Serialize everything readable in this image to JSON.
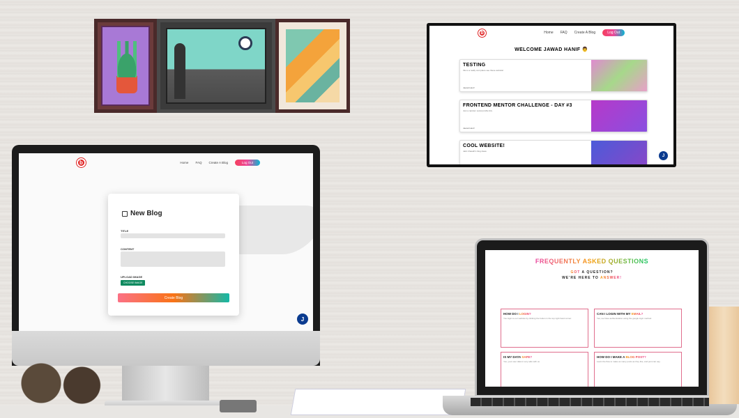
{
  "wall_art": [
    "succulent-painting",
    "starry-night-painting",
    "abstract-painting"
  ],
  "tv": {
    "logo": "b",
    "nav": [
      "Home",
      "FAQ",
      "Create A Blog"
    ],
    "logout": "Log Out",
    "welcome": "WELCOME JAWAD HANIF",
    "posts": [
      {
        "title": "TESTING",
        "excerpt": "this is a really cool place see these website!",
        "author": "Jawad Hanif"
      },
      {
        "title": "FRONTEND MENTOR CHALLENGE - DAY #3",
        "excerpt": "Just a random social profile link.",
        "author": "Jawad Hanif"
      },
      {
        "title": "COOL WEBSITE!",
        "excerpt": "Jatin bhaadri's blog ideas",
        "author": ""
      }
    ],
    "avatar": "J"
  },
  "imac": {
    "logo": "b",
    "nav": [
      "Home",
      "FAQ",
      "Create A Blog"
    ],
    "logout": "Log Out",
    "form_title": "New Blog",
    "title_label": "TITLE",
    "content_label": "CONTENT",
    "upload_label": "UPLOAD IMAGE",
    "choose_label": "CHOOSE IMAGE",
    "submit_label": "Create Blog",
    "avatar": "J"
  },
  "laptop": {
    "title": "FREQUENTLY ASKED QUESTIONS",
    "sub1_pre": "GOT",
    "sub1_post": "A QUESTION?",
    "sub2_pre": "WE'RE HERE TO",
    "sub2_post": "ANSWER!",
    "faqs": [
      {
        "q_pre": "HOW DO I",
        "q_hl": "LOGIN?",
        "a": "You login to our website by clicking the button in the top right hand corner."
      },
      {
        "q_pre": "CAN I LOGIN WITH MY",
        "q_hl": "EMAIL?",
        "a": "Yes, we have authentication using the google login method."
      },
      {
        "q_pre": "IS MY DATA",
        "q_hl": "SAFE?",
        "a": "Yes, your user data is very safe with us."
      },
      {
        "q_pre": "HOW DO I MAKE A",
        "q_hl": "BLOG POST?",
        "a": "Learn the flow to make as many posts as they like, and post can say."
      }
    ]
  }
}
